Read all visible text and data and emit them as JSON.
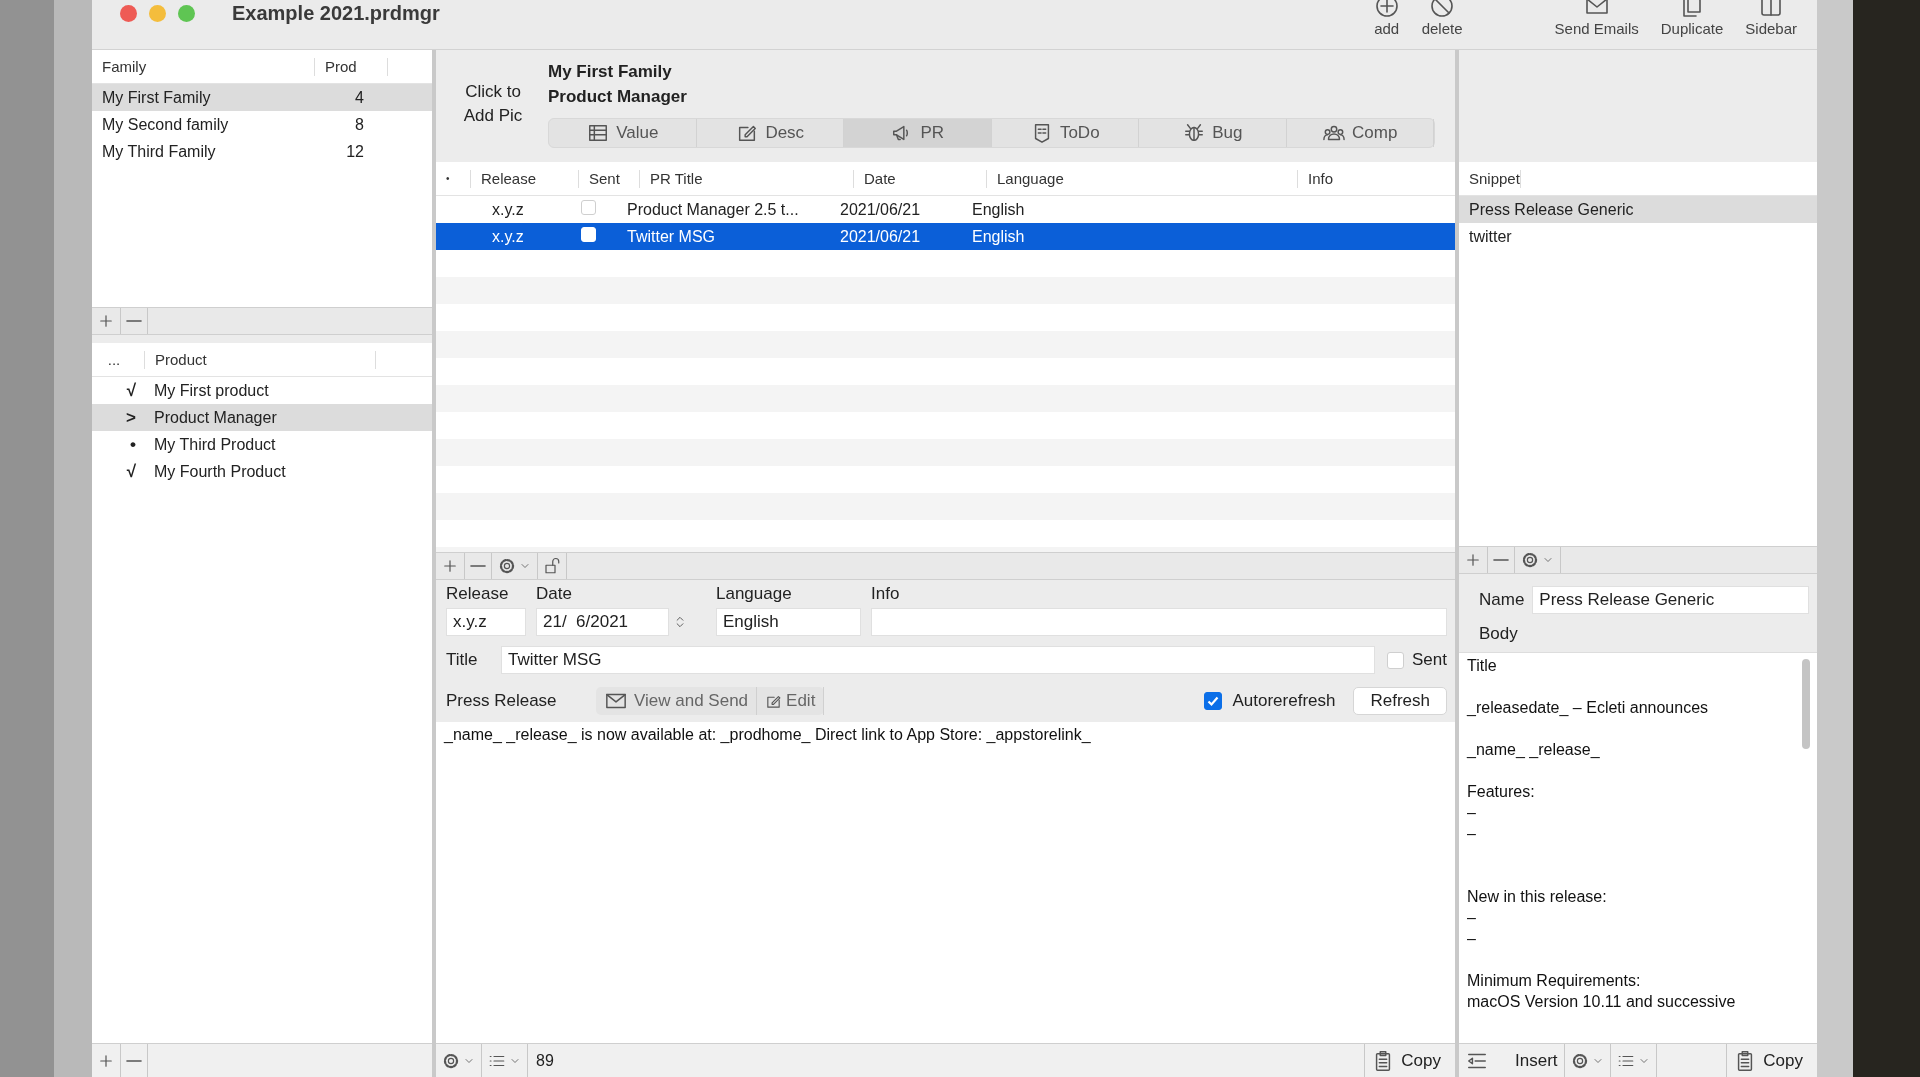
{
  "window": {
    "title": "Example 2021.prdmgr"
  },
  "toolbar": [
    {
      "kind": "add",
      "label": "add"
    },
    {
      "kind": "delete",
      "label": "delete"
    },
    {
      "kind": "mail",
      "label": "Send Emails"
    },
    {
      "kind": "duplicate",
      "label": "Duplicate"
    },
    {
      "kind": "sidebar",
      "label": "Sidebar"
    }
  ],
  "families": {
    "columns": [
      "Family",
      "Prod"
    ],
    "rows": [
      {
        "name": "My First Family",
        "count": "4",
        "selected": true
      },
      {
        "name": "My Second family",
        "count": "8",
        "selected": false
      },
      {
        "name": "My Third Family",
        "count": "12",
        "selected": false
      }
    ]
  },
  "products": {
    "columns": [
      "...",
      "Product"
    ],
    "rows": [
      {
        "mark": "√",
        "name": "My First product",
        "selected": false
      },
      {
        "mark": ">",
        "name": "Product Manager",
        "selected": true
      },
      {
        "mark": "•",
        "name": "My Third Product",
        "selected": false
      },
      {
        "mark": "√",
        "name": "My Fourth Product",
        "selected": false
      }
    ]
  },
  "header": {
    "pic_hint": "Click to Add Pic",
    "family": "My First Family",
    "product": "Product Manager"
  },
  "tabs": [
    {
      "kind": "value",
      "label": "Value",
      "selected": false
    },
    {
      "kind": "desc",
      "label": "Desc",
      "selected": false
    },
    {
      "kind": "pr",
      "label": "PR",
      "selected": true
    },
    {
      "kind": "todo",
      "label": "ToDo",
      "selected": false
    },
    {
      "kind": "bug",
      "label": "Bug",
      "selected": false
    },
    {
      "kind": "comp",
      "label": "Comp",
      "selected": false
    }
  ],
  "pr_table": {
    "columns": [
      "•",
      "Release",
      "Sent",
      "PR Title",
      "Date",
      "Language",
      "Info"
    ],
    "rows": [
      {
        "release": "x.y.z",
        "sent": false,
        "title": "Product Manager 2.5 t...",
        "date": "2021/06/21",
        "language": "English",
        "selected": false
      },
      {
        "release": "x.y.z",
        "sent": false,
        "title": "Twitter MSG",
        "date": "2021/06/21",
        "language": "English",
        "selected": true
      }
    ]
  },
  "pr_form": {
    "release_label": "Release",
    "date_label": "Date",
    "language_label": "Language",
    "info_label": "Info",
    "release": "x.y.z",
    "date": "21/  6/2021",
    "language": "English",
    "title_label": "Title",
    "title": "Twitter MSG",
    "sent_label": "Sent",
    "sent": false,
    "press_release_label": "Press Release",
    "view_send": "View and Send",
    "edit": "Edit",
    "autorefresh_label": "Autorerefresh",
    "autorefresh": true,
    "refresh": "Refresh",
    "body": "_name_ _release_ is now available at: _prodhome_ Direct link to App Store: _appstorelink_"
  },
  "snippets": {
    "column": "Snippet",
    "rows": [
      {
        "name": "Press Release Generic",
        "selected": true
      },
      {
        "name": "twitter",
        "selected": false
      }
    ]
  },
  "snippet_form": {
    "name_label": "Name",
    "name": "Press Release Generic",
    "body_label": "Body",
    "body": "Title\n\n_releasedate_ – Ecleti announces\n\n_name_ _release_\n\nFeatures:\n–\n–\n\n\nNew in this release:\n–\n–\n\nMinimum Requirements:\nmacOS Version 10.11 and successive"
  },
  "status_bar": {
    "count": "89",
    "copy": "Copy",
    "insert": "Insert",
    "snippet_copy": "Copy"
  }
}
